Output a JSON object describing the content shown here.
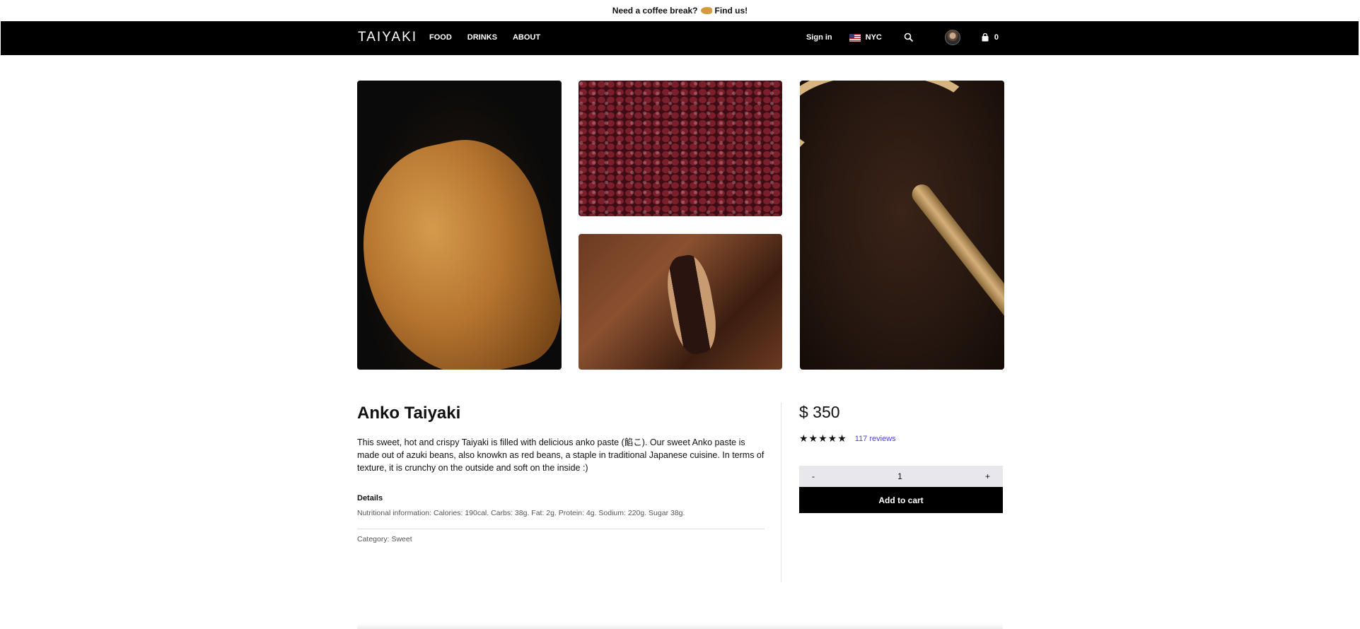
{
  "announcement": {
    "text_before": "Need a coffee break?",
    "emoji_icon": "taiyaki-icon",
    "link": "Find us!"
  },
  "nav": {
    "logo": "TAIYAKI",
    "links": [
      "FOOD",
      "DRINKS",
      "ABOUT"
    ],
    "sign_in": "Sign in",
    "location": "NYC",
    "cart_count": "0",
    "icons": [
      "us-flag-icon",
      "search-icon",
      "avatar",
      "shopping-bag-icon"
    ]
  },
  "gallery": {
    "images": [
      "taiyaki-fish-image",
      "azuki-beans-image",
      "cut-taiyaki-image",
      "anko-paste-image"
    ]
  },
  "product": {
    "title": "Anko Taiyaki",
    "description": "This sweet, hot and crispy Taiyaki is filled with delicious anko paste (餡こ). Our sweet Anko paste is made out of azuki beans, also knowkn as red beans, a staple in traditional Japanese cuisine. In terms of texture, it is crunchy on the outside and soft on the inside :)",
    "details_label": "Details",
    "details_text": "Nutritional information: Calories: 190cal. Carbs: 38g. Fat: 2g. Protein: 4g. Sodium: 220g. Sugar 38g.",
    "category": "Category: Sweet",
    "price": "$ 350",
    "rating": 5,
    "stars": "★★★★★",
    "reviews": "117 reviews",
    "qty_minus": "-",
    "qty_value": "1",
    "qty_plus": "+",
    "add_to_cart": "Add to cart"
  },
  "colors": {
    "nav_bg": "#000000",
    "accent_link": "#4a3fd8",
    "qty_bg": "#e8e8ec"
  }
}
